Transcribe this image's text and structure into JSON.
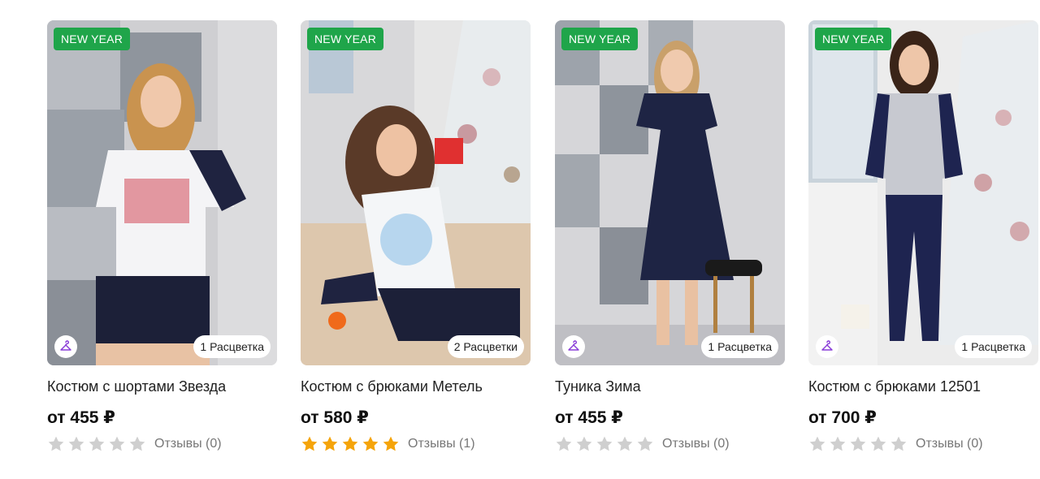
{
  "colors": {
    "badge_green": "#1fa54a",
    "star_active": "#f5a40a",
    "star_inactive": "#cfcfcf",
    "hanger_purple": "#8a3ed8"
  },
  "products": [
    {
      "badge": "NEW YEAR",
      "colors_label": "1 Расцветка",
      "title": "Костюм с шортами Звезда",
      "price": "от 455 ₽",
      "rating": 0,
      "reviews": "Отзывы (0)",
      "icon": "hanger-icon"
    },
    {
      "badge": "NEW YEAR",
      "colors_label": "2 Расцветки",
      "title": "Костюм с брюками Метель",
      "price": "от 580 ₽",
      "rating": 5,
      "reviews": "Отзывы (1)",
      "icon": "hanger-icon"
    },
    {
      "badge": "NEW YEAR",
      "colors_label": "1 Расцветка",
      "title": "Туника Зима",
      "price": "от 455 ₽",
      "rating": 0,
      "reviews": "Отзывы (0)",
      "icon": "hanger-icon"
    },
    {
      "badge": "NEW YEAR",
      "colors_label": "1 Расцветка",
      "title": "Костюм с брюками 12501",
      "price": "от 700 ₽",
      "rating": 0,
      "reviews": "Отзывы (0)",
      "icon": "hanger-icon"
    }
  ]
}
